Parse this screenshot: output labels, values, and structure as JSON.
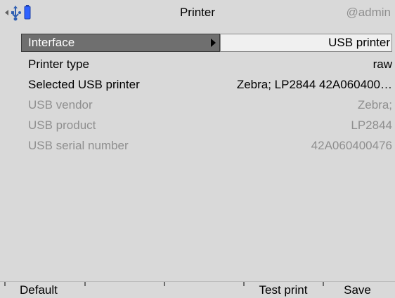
{
  "header": {
    "title": "Printer",
    "user": "@admin",
    "icons": {
      "left_arrow": "left-arrow-icon",
      "usb": "usb-icon",
      "battery": "battery-icon"
    },
    "colors": {
      "usb": "#2f5fb2",
      "battery": "#2f62ff"
    }
  },
  "settings": {
    "rows": [
      {
        "label": "Interface",
        "value": "USB printer"
      },
      {
        "label": "Printer type",
        "value": "raw"
      },
      {
        "label": "Selected USB printer",
        "value": "Zebra; LP2844 42A060400…"
      },
      {
        "label": "USB vendor",
        "value": "Zebra;"
      },
      {
        "label": "USB product",
        "value": "LP2844"
      },
      {
        "label": "USB serial number",
        "value": "42A060400476"
      }
    ]
  },
  "footer": {
    "buttons": [
      {
        "label": "Default"
      },
      {
        "label": ""
      },
      {
        "label": ""
      },
      {
        "label": "Test print"
      },
      {
        "label": "Save"
      }
    ]
  }
}
